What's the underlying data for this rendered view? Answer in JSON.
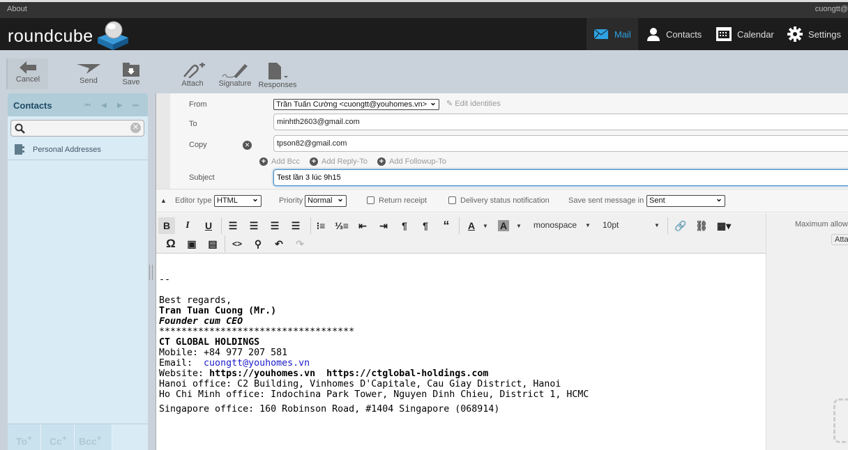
{
  "topbar": {
    "about": "About",
    "user": "cuongtt@"
  },
  "brand": {
    "logo_text": "roundcube"
  },
  "nav": [
    {
      "label": "Mail",
      "icon": "envelope-icon",
      "active": true
    },
    {
      "label": "Contacts",
      "icon": "person-icon"
    },
    {
      "label": "Calendar",
      "icon": "calendar-icon"
    },
    {
      "label": "Settings",
      "icon": "gear-icon"
    }
  ],
  "toolbar": {
    "cancel": "Cancel",
    "send": "Send",
    "save": "Save",
    "attach": "Attach",
    "signature": "Signature",
    "responses": "Responses"
  },
  "contacts": {
    "title": "Contacts",
    "search_placeholder": "",
    "items": [
      "Personal Addresses"
    ],
    "footer": [
      "To",
      "Cc",
      "Bcc"
    ]
  },
  "headers": {
    "from_label": "From",
    "from_value": "Trần Tuấn Cường <cuongtt@youhomes.vn>",
    "edit_identities": "Edit identities",
    "to_label": "To",
    "to_value": "minhth2603@gmail.com",
    "copy_label": "Copy",
    "copy_value": "tpson82@gmail.com",
    "add_bcc": "Add Bcc",
    "add_reply_to": "Add Reply-To",
    "add_followup_to": "Add Followup-To",
    "subject_label": "Subject",
    "subject_value": "Test lần 3 lúc 9h15"
  },
  "options": {
    "editor_type_label": "Editor type",
    "editor_type": "HTML",
    "priority_label": "Priority",
    "priority": "Normal",
    "return_receipt": "Return receipt",
    "dsn": "Delivery status notification",
    "save_label": "Save sent message in",
    "save_folder": "Sent"
  },
  "editor": {
    "font": "monospace",
    "size": "10pt"
  },
  "attachments": {
    "max_allowed": "Maximum allowe",
    "attach_button": "Atta"
  },
  "body": {
    "sep": "--",
    "greeting": "Best regards,",
    "name": "Tran Tuan Cuong (Mr.)",
    "title": "Founder cum CEO",
    "stars": "***********************************",
    "company": "CT GLOBAL HOLDINGS",
    "mobile": "Mobile: +84 977 207 581",
    "email_label": "Email:  ",
    "email": "cuongtt@youhomes.vn",
    "website_label": "Website: ",
    "websites": "https://youhomes.vn  https://ctglobal-holdings.com",
    "hanoi": "Hanoi office: C2 Building, Vinhomes D'Capitale, Cau Giay District, Hanoi",
    "hcm": "Ho Chi Minh office: Indochina Park Tower, Nguyen Dinh Chieu, District 1, HCMC",
    "singapore": "Singapore office: 160 Robinson Road, #1404 Singapore (068914)"
  }
}
